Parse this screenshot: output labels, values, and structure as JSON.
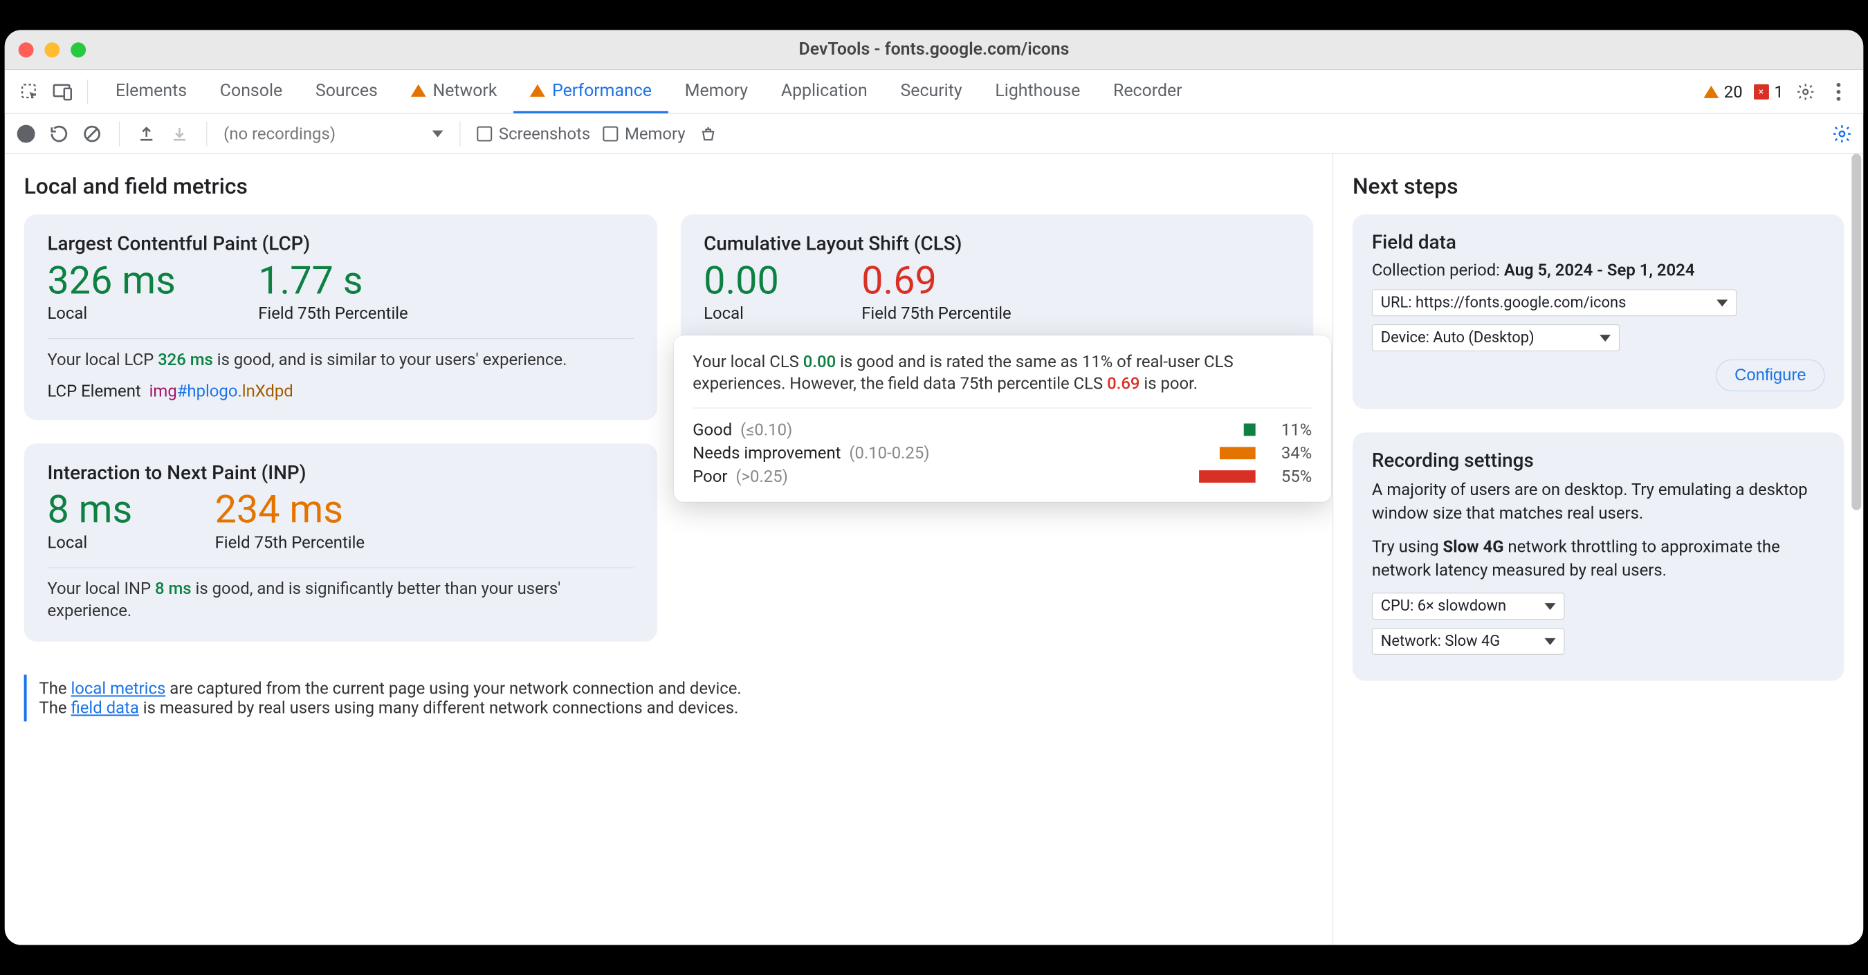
{
  "window": {
    "title": "DevTools - fonts.google.com/icons"
  },
  "tabs": {
    "items": [
      "Elements",
      "Console",
      "Sources",
      "Network",
      "Performance",
      "Memory",
      "Application",
      "Security",
      "Lighthouse",
      "Recorder"
    ],
    "active": "Performance",
    "warn_tabs": [
      "Network",
      "Performance"
    ],
    "warn_count": "20",
    "err_count": "1"
  },
  "toolbar": {
    "recordings_placeholder": "(no recordings)",
    "screenshots_label": "Screenshots",
    "memory_label": "Memory"
  },
  "main_title": "Local and field metrics",
  "lcp": {
    "title": "Largest Contentful Paint (LCP)",
    "local_value": "326 ms",
    "local_label": "Local",
    "field_value": "1.77 s",
    "field_label": "Field 75th Percentile",
    "desc_prefix": "Your local LCP ",
    "desc_value": "326 ms",
    "desc_suffix": " is good, and is similar to your users' experience.",
    "lcp_element_label": "LCP Element",
    "lcp_tag": "img",
    "lcp_id": "#hplogo",
    "lcp_cls": ".lnXdpd"
  },
  "cls": {
    "title": "Cumulative Layout Shift (CLS)",
    "local_value": "0.00",
    "local_label": "Local",
    "field_value": "0.69",
    "field_label": "Field 75th Percentile",
    "pop_pre1": "Your local CLS ",
    "pop_v1": "0.00",
    "pop_mid": " is good and is rated the same as 11% of real-user CLS experiences. However, the field data 75th percentile CLS ",
    "pop_v2": "0.69",
    "pop_end": " is poor.",
    "rows": [
      {
        "label": "Good",
        "range": "(≤0.10)",
        "pct": "11%",
        "barw": 17,
        "cls": "good"
      },
      {
        "label": "Needs improvement",
        "range": "(0.10-0.25)",
        "pct": "34%",
        "barw": 52,
        "cls": "need"
      },
      {
        "label": "Poor",
        "range": "(>0.25)",
        "pct": "55%",
        "barw": 82,
        "cls": "poor"
      }
    ]
  },
  "inp": {
    "title": "Interaction to Next Paint (INP)",
    "local_value": "8 ms",
    "local_label": "Local",
    "field_value": "234 ms",
    "field_label": "Field 75th Percentile",
    "desc_prefix": "Your local INP ",
    "desc_value": "8 ms",
    "desc_suffix": " is good, and is significantly better than your users' experience."
  },
  "tip": {
    "t1a": "The ",
    "l1": "local metrics",
    "t1b": " are captured from the current page using your network connection and device.",
    "t2a": "The ",
    "l2": "field data",
    "t2b": " is measured by real users using many different network connections and devices."
  },
  "side_title": "Next steps",
  "field_panel": {
    "title": "Field data",
    "period_label": "Collection period: ",
    "period_value": "Aug 5, 2024 - Sep 1, 2024",
    "url_sel": "URL: https://fonts.google.com/icons",
    "device_sel": "Device: Auto (Desktop)",
    "configure": "Configure"
  },
  "rec_panel": {
    "title": "Recording settings",
    "p1": "A majority of users are on desktop. Try emulating a desktop window size that matches real users.",
    "p2a": "Try using ",
    "p2b_bold": "Slow 4G",
    "p2c": " network throttling to approximate the network latency measured by real users.",
    "cpu_sel": "CPU: 6× slowdown",
    "net_sel": "Network: Slow 4G"
  }
}
